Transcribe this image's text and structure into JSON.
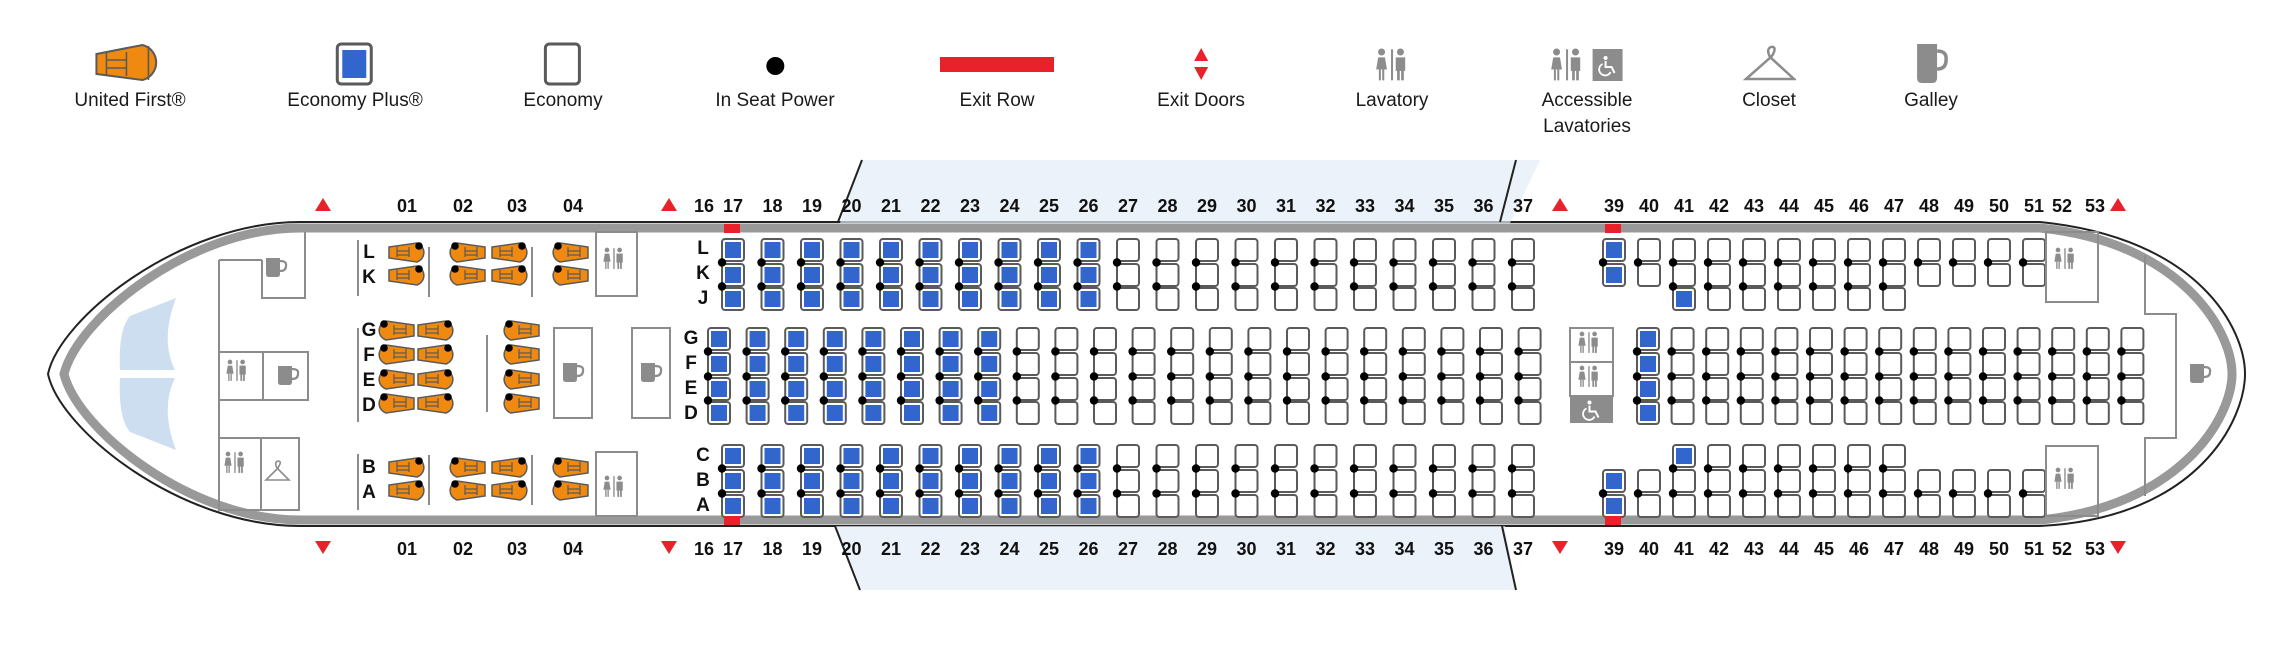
{
  "legend": [
    {
      "key": "first",
      "label": "United First®",
      "icon": "first-class-seat-icon"
    },
    {
      "key": "plus",
      "label": "Economy Plus®",
      "icon": "economy-plus-seat-icon"
    },
    {
      "key": "economy",
      "label": "Economy",
      "icon": "economy-seat-icon"
    },
    {
      "key": "power",
      "label": "In Seat Power",
      "icon": "power-outlet-icon"
    },
    {
      "key": "exitrow",
      "label": "Exit Row",
      "icon": "exit-row-icon"
    },
    {
      "key": "exitdoors",
      "label": "Exit Doors",
      "icon": "exit-doors-icon"
    },
    {
      "key": "lav",
      "label": "Lavatory",
      "icon": "lavatory-icon"
    },
    {
      "key": "acclav",
      "label": "Accessible\nLavatories",
      "icon": "accessible-lavatory-icon"
    },
    {
      "key": "closet",
      "label": "Closet",
      "icon": "closet-icon"
    },
    {
      "key": "galley",
      "label": "Galley",
      "icon": "galley-icon"
    }
  ],
  "colors": {
    "first": "#f0890f",
    "plus": "#3366cc",
    "seat_border": "#5a5a5a",
    "exit": "#e8212b",
    "fixture": "#8c8c8c",
    "fuselage": "#999999",
    "wing": "#c9daf0"
  },
  "first_class": {
    "rows": [
      "01",
      "02",
      "03",
      "04"
    ],
    "outer_letters_top": [
      "L",
      "K"
    ],
    "center_letters": [
      "G",
      "F",
      "E",
      "D"
    ],
    "outer_letters_bottom": [
      "B",
      "A"
    ],
    "center_rows": [
      "01",
      "02",
      "03"
    ]
  },
  "economy": {
    "row_labels_top": [
      "16",
      "17",
      "18",
      "19",
      "20",
      "21",
      "22",
      "23",
      "24",
      "25",
      "26",
      "27",
      "28",
      "29",
      "30",
      "31",
      "32",
      "33",
      "34",
      "35",
      "36",
      "37",
      "39",
      "40",
      "41",
      "42",
      "43",
      "44",
      "45",
      "46",
      "47",
      "48",
      "49",
      "50",
      "51",
      "52",
      "53"
    ],
    "side_letters_top": [
      "L",
      "K",
      "J"
    ],
    "center_letters": [
      "G",
      "F",
      "E",
      "D"
    ],
    "side_letters_bottom": [
      "C",
      "B",
      "A"
    ],
    "forward_section": {
      "side_rows": [
        "17",
        "18",
        "19",
        "20",
        "21",
        "22",
        "23",
        "24",
        "25",
        "26",
        "27",
        "28",
        "29",
        "30",
        "31",
        "32",
        "33",
        "34",
        "35",
        "36",
        "37"
      ],
      "center_rows": [
        "16",
        "17",
        "18",
        "19",
        "20",
        "21",
        "22",
        "23",
        "24",
        "25",
        "26",
        "27",
        "28",
        "29",
        "30",
        "31",
        "32",
        "33",
        "34",
        "35",
        "36",
        "37"
      ],
      "plus_side_rows": [
        "17",
        "18",
        "19",
        "20",
        "21",
        "22",
        "23",
        "24",
        "25",
        "26"
      ],
      "plus_center_rows": [
        "16",
        "17",
        "18",
        "19",
        "20",
        "21",
        "22",
        "23"
      ]
    },
    "aft_section": {
      "center_rows": [
        "39",
        "40",
        "41",
        "42",
        "43",
        "44",
        "45",
        "46",
        "47",
        "48",
        "49",
        "50",
        "51",
        "52",
        "53"
      ],
      "plus_center_rows": [
        "39"
      ],
      "top_rows": [
        {
          "row": "39",
          "seats": [
            "L",
            "K"
          ],
          "plus": [
            "L",
            "K"
          ]
        },
        {
          "row": "40",
          "seats": [
            "L",
            "K"
          ],
          "plus": []
        },
        {
          "row": "41",
          "seats": [
            "L",
            "K",
            "J"
          ],
          "plus": [
            "J"
          ]
        },
        {
          "row": "42",
          "seats": [
            "L",
            "K",
            "J"
          ],
          "plus": []
        },
        {
          "row": "43",
          "seats": [
            "L",
            "K",
            "J"
          ],
          "plus": []
        },
        {
          "row": "44",
          "seats": [
            "L",
            "K",
            "J"
          ],
          "plus": []
        },
        {
          "row": "45",
          "seats": [
            "L",
            "K",
            "J"
          ],
          "plus": []
        },
        {
          "row": "46",
          "seats": [
            "L",
            "K",
            "J"
          ],
          "plus": []
        },
        {
          "row": "47",
          "seats": [
            "L",
            "K",
            "J"
          ],
          "plus": []
        },
        {
          "row": "48",
          "seats": [
            "L",
            "K"
          ],
          "plus": []
        },
        {
          "row": "49",
          "seats": [
            "L",
            "K"
          ],
          "plus": []
        },
        {
          "row": "50",
          "seats": [
            "L",
            "K"
          ],
          "plus": []
        },
        {
          "row": "51",
          "seats": [
            "L",
            "K"
          ],
          "plus": []
        }
      ],
      "bottom_rows": [
        {
          "row": "39",
          "seats": [
            "B",
            "A"
          ],
          "plus": [
            "B",
            "A"
          ]
        },
        {
          "row": "40",
          "seats": [
            "B",
            "A"
          ],
          "plus": []
        },
        {
          "row": "41",
          "seats": [
            "C",
            "B",
            "A"
          ],
          "plus": [
            "C"
          ]
        },
        {
          "row": "42",
          "seats": [
            "C",
            "B",
            "A"
          ],
          "plus": []
        },
        {
          "row": "43",
          "seats": [
            "C",
            "B",
            "A"
          ],
          "plus": []
        },
        {
          "row": "44",
          "seats": [
            "C",
            "B",
            "A"
          ],
          "plus": []
        },
        {
          "row": "45",
          "seats": [
            "C",
            "B",
            "A"
          ],
          "plus": []
        },
        {
          "row": "46",
          "seats": [
            "C",
            "B",
            "A"
          ],
          "plus": []
        },
        {
          "row": "47",
          "seats": [
            "C",
            "B",
            "A"
          ],
          "plus": []
        },
        {
          "row": "48",
          "seats": [
            "B",
            "A"
          ],
          "plus": []
        },
        {
          "row": "49",
          "seats": [
            "B",
            "A"
          ],
          "plus": []
        },
        {
          "row": "50",
          "seats": [
            "B",
            "A"
          ],
          "plus": []
        },
        {
          "row": "51",
          "seats": [
            "B",
            "A"
          ],
          "plus": []
        }
      ]
    },
    "exit_rows": [
      "17",
      "39"
    ]
  },
  "exit_doors_after_rows": [
    "front",
    "04",
    "37",
    "53"
  ]
}
